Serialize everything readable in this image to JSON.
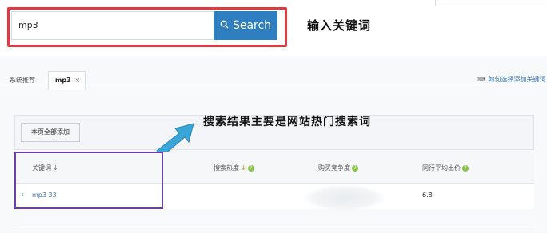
{
  "search": {
    "query": "mp3",
    "button_label": "Search"
  },
  "annotations": {
    "top": "输入关键词",
    "middle": "搜索结果主要是网站热门搜索词"
  },
  "tabs": [
    {
      "label": "系统推荐"
    },
    {
      "label": "mp3",
      "close": "×"
    }
  ],
  "help_link": "如何选择添加关键词",
  "toolbar": {
    "add_all_label": "本页全部添加"
  },
  "table": {
    "columns": [
      "关键词",
      "搜索热度",
      "购买竞争度",
      "同行平均出价"
    ],
    "rows": [
      {
        "keyword": "mp3 33",
        "bid": "6.8"
      }
    ]
  },
  "colors": {
    "callout_red": "#e0393e",
    "callout_purple": "#6b3fa6",
    "search_blue": "#2f7fc0",
    "arrow_blue": "#3aa6d8"
  }
}
